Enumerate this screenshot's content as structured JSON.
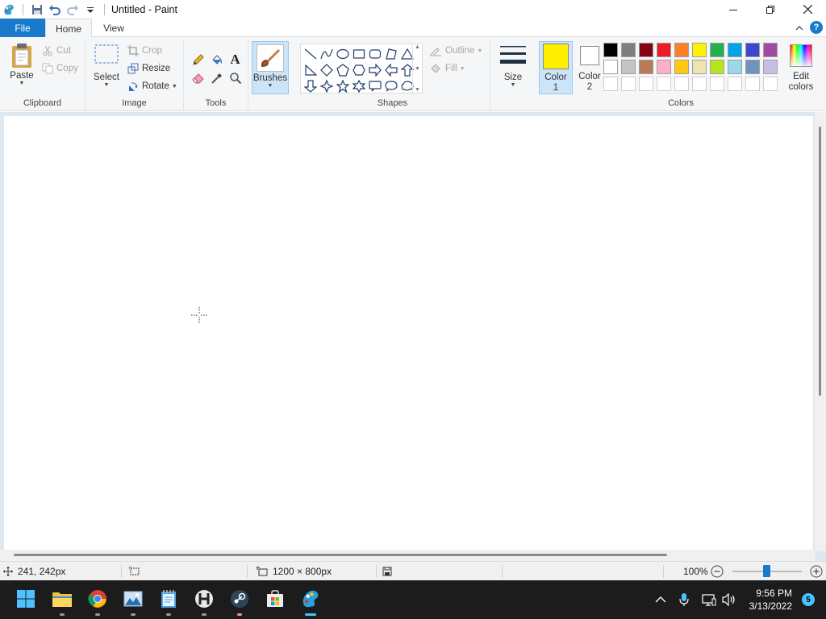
{
  "app": {
    "title": "Untitled - Paint"
  },
  "tabs": {
    "file": "File",
    "home": "Home",
    "view": "View"
  },
  "ribbon": {
    "clipboard": {
      "label": "Clipboard",
      "paste": "Paste",
      "cut": "Cut",
      "copy": "Copy"
    },
    "image": {
      "label": "Image",
      "select": "Select",
      "crop": "Crop",
      "resize": "Resize",
      "rotate": "Rotate"
    },
    "tools": {
      "label": "Tools"
    },
    "brushes": {
      "label": "Brushes"
    },
    "shapes": {
      "label": "Shapes",
      "outline": "Outline",
      "fill": "Fill"
    },
    "size": {
      "label": "Size"
    },
    "colors": {
      "label": "Colors",
      "color1_line1": "Color",
      "color1_line2": "1",
      "color2_line1": "Color",
      "color2_line2": "2",
      "edit_line1": "Edit",
      "edit_line2": "colors",
      "color1_value": "#ffef00",
      "color2_value": "#ffffff",
      "palette_row1": [
        "#000000",
        "#7f7f7f",
        "#880015",
        "#ed1c24",
        "#ff7f27",
        "#fff200",
        "#22b14c",
        "#00a2e8",
        "#3f48cc",
        "#a349a4"
      ],
      "palette_row2": [
        "#ffffff",
        "#c3c3c3",
        "#b97a57",
        "#ffaec9",
        "#ffc90e",
        "#efe4b0",
        "#b5e61d",
        "#99d9ea",
        "#7092be",
        "#c8bfe7"
      ]
    }
  },
  "status": {
    "cursor_pos": "241, 242px",
    "canvas_size": "1200 × 800px",
    "zoom": "100%"
  },
  "taskbar": {
    "time": "9:56 PM",
    "date": "3/13/2022",
    "notifications": "5"
  }
}
